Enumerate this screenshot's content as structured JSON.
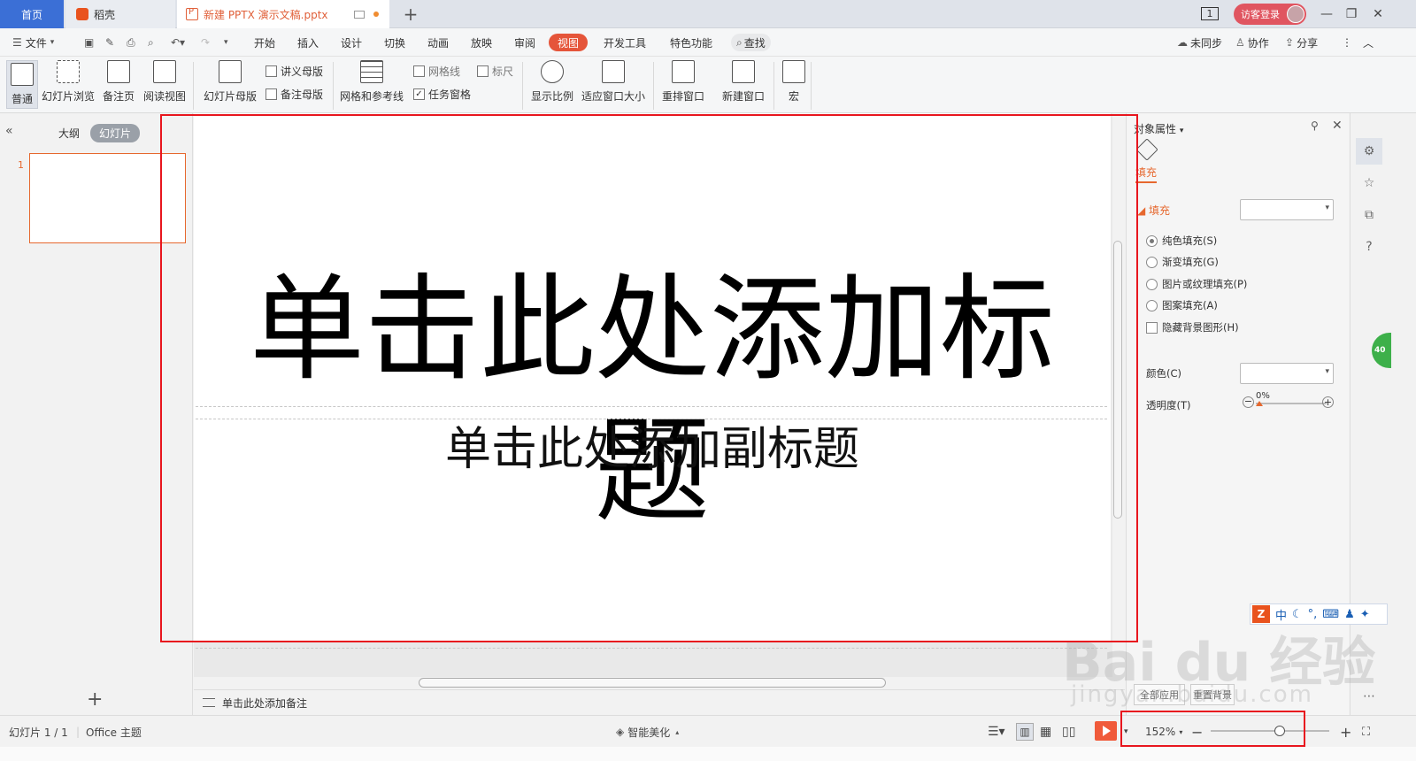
{
  "tabs": {
    "home": "首页",
    "daoke": "稻壳",
    "doc": "新建 PPTX 演示文稿.pptx"
  },
  "window": {
    "count_badge": "1",
    "login": "访客登录"
  },
  "menu": {
    "file": "文件",
    "items": [
      "开始",
      "插入",
      "设计",
      "切换",
      "动画",
      "放映",
      "审阅",
      "视图",
      "开发工具",
      "特色功能"
    ],
    "active": "视图",
    "search": "查找",
    "sync": "未同步",
    "collab": "协作",
    "share": "分享"
  },
  "ribbon": {
    "normal": "普通",
    "slide_browse": "幻灯片浏览",
    "notes_page": "备注页",
    "reading_view": "阅读视图",
    "slide_master": "幻灯片母版",
    "handout_master": "讲义母版",
    "notes_master": "备注母版",
    "grid_guides": "网格和参考线",
    "gridlines": "网格线",
    "ruler": "标尺",
    "task_pane": "任务窗格",
    "zoom": "显示比例",
    "fit_window": "适应窗口大小",
    "arrange": "重排窗口",
    "new_window": "新建窗口",
    "macro": "宏"
  },
  "left_panel": {
    "outline": "大纲",
    "slides": "幻灯片",
    "slide_number": "1"
  },
  "slide": {
    "title": "单击此处添加标题",
    "subtitle": "单击此处添加副标题"
  },
  "notes": {
    "placeholder": "单击此处添加备注"
  },
  "right_panel": {
    "title": "对象属性",
    "tab_fill": "填充",
    "section_fill": "填充",
    "options": [
      "纯色填充(S)",
      "渐变填充(G)",
      "图片或纹理填充(P)",
      "图案填充(A)"
    ],
    "selected_option": "纯色填充(S)",
    "hide_bg": "隐藏背景图形(H)",
    "color": "颜色(C)",
    "transparency": "透明度(T)",
    "transparency_value": "0%",
    "apply_all": "全部应用",
    "reset_bg": "重置背景"
  },
  "statusbar": {
    "slide_info": "幻灯片 1 / 1",
    "theme": "Office 主题",
    "beautify": "智能美化",
    "zoom": "152%",
    "zoom_fraction": 0.58
  },
  "ime": {
    "mode": "中"
  },
  "watermark": {
    "brand": "Bai du 经验",
    "url": "jingyan.baidu.com"
  },
  "colors": {
    "accent": "#e5553a",
    "highlight": "#e8161e",
    "home_tab": "#3b6fd6"
  }
}
